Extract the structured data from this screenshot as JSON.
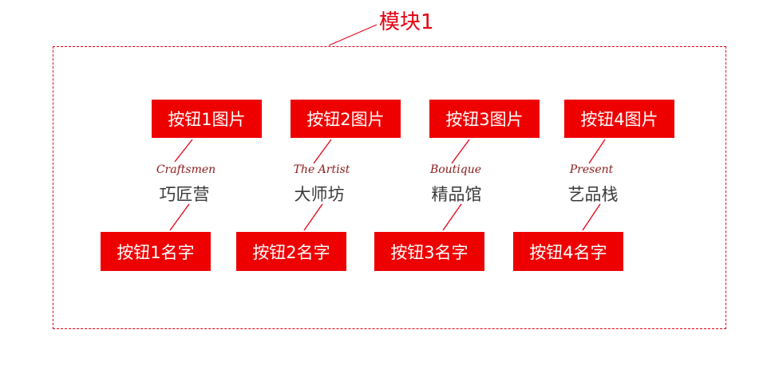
{
  "module": {
    "title": "模块1"
  },
  "items": [
    {
      "image_button": "按钮1图片",
      "english": "Craftsmen",
      "chinese": "巧匠营",
      "name_button": "按钮1名字"
    },
    {
      "image_button": "按钮2图片",
      "english": "The Artist",
      "chinese": "大师坊",
      "name_button": "按钮2名字"
    },
    {
      "image_button": "按钮3图片",
      "english": "Boutique",
      "chinese": "精品馆",
      "name_button": "按钮3名字"
    },
    {
      "image_button": "按钮4图片",
      "english": "Present",
      "chinese": "艺品栈",
      "name_button": "按钮4名字"
    }
  ],
  "colors": {
    "accent": "#e60012",
    "button_bg": "#ee0000",
    "english_text": "#8b1a1a",
    "chinese_text": "#3a3a3a"
  }
}
